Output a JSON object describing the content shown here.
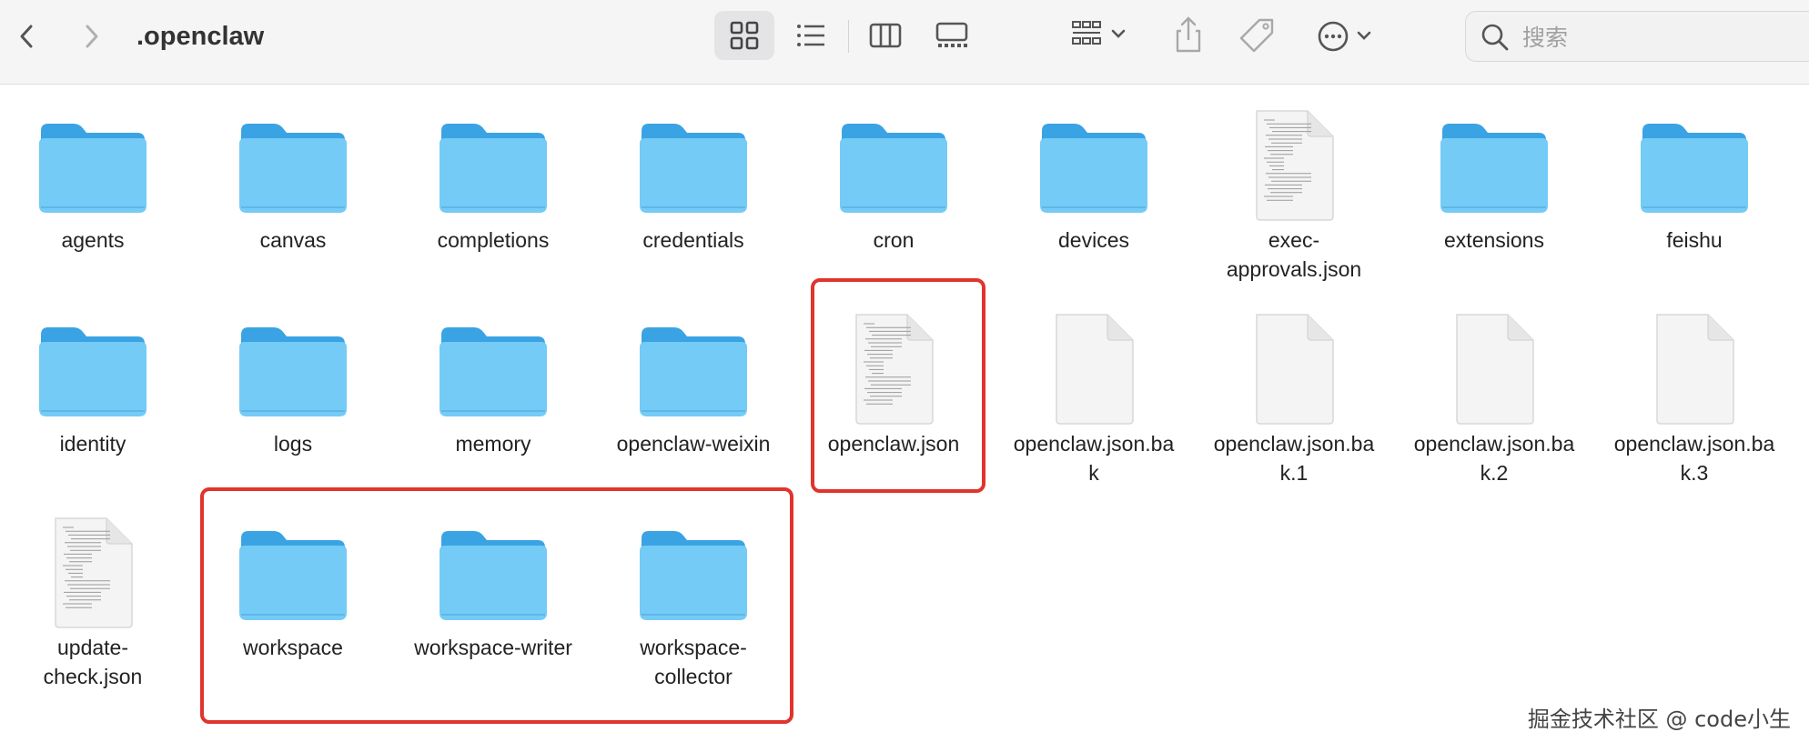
{
  "window": {
    "title": ".openclaw",
    "search_placeholder": "搜索"
  },
  "toolbar": {
    "icons": [
      "chevron-left-icon",
      "chevron-right-icon",
      "icon-view-icon",
      "list-view-icon",
      "column-view-icon",
      "gallery-view-icon",
      "group-icon",
      "share-icon",
      "tag-icon",
      "more-icon",
      "search-icon"
    ],
    "active_view": "icon-view"
  },
  "items": [
    {
      "name": "agents",
      "kind": "folder"
    },
    {
      "name": "canvas",
      "kind": "folder"
    },
    {
      "name": "completions",
      "kind": "folder"
    },
    {
      "name": "credentials",
      "kind": "folder"
    },
    {
      "name": "cron",
      "kind": "folder"
    },
    {
      "name": "devices",
      "kind": "folder"
    },
    {
      "name": "exec-\napprovals.json",
      "kind": "doc-text"
    },
    {
      "name": "extensions",
      "kind": "folder"
    },
    {
      "name": "feishu",
      "kind": "folder"
    },
    {
      "name": "identity",
      "kind": "folder"
    },
    {
      "name": "logs",
      "kind": "folder"
    },
    {
      "name": "memory",
      "kind": "folder"
    },
    {
      "name": "openclaw-weixin",
      "kind": "folder"
    },
    {
      "name": "openclaw.json",
      "kind": "doc-text"
    },
    {
      "name": "openclaw.json.ba\nk",
      "kind": "doc"
    },
    {
      "name": "openclaw.json.ba\nk.1",
      "kind": "doc"
    },
    {
      "name": "openclaw.json.ba\nk.2",
      "kind": "doc"
    },
    {
      "name": "openclaw.json.ba\nk.3",
      "kind": "doc"
    },
    {
      "name": "update-\ncheck.json",
      "kind": "doc-text"
    },
    {
      "name": "workspace",
      "kind": "folder"
    },
    {
      "name": "workspace-writer",
      "kind": "folder"
    },
    {
      "name": "workspace-\ncollector",
      "kind": "folder"
    }
  ],
  "colors": {
    "folder_back": "#3aa3e4",
    "folder_front": "#74cbf6",
    "highlight": "#e0342c"
  },
  "watermark": "掘金技术社区 @ code小生"
}
